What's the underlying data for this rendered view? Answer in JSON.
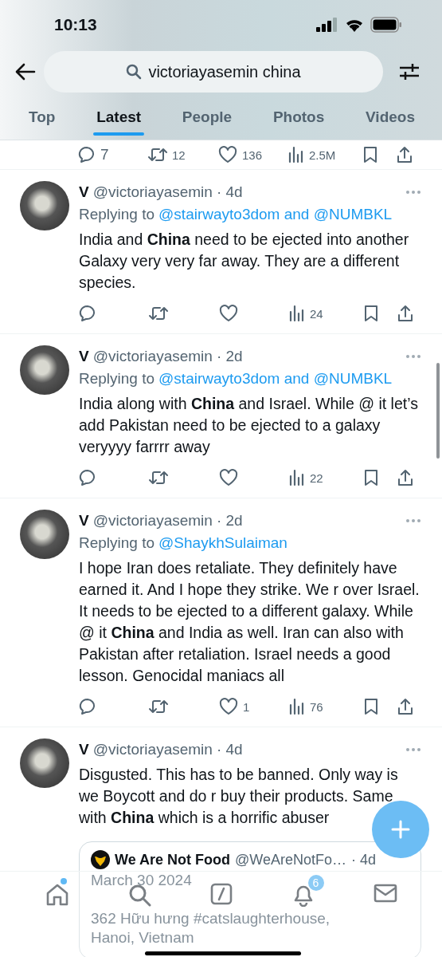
{
  "status_bar": {
    "time": "10:13"
  },
  "search": {
    "value": "victoriayasemin china"
  },
  "tabs": [
    {
      "label": "Top",
      "selected": false
    },
    {
      "label": "Latest",
      "selected": true
    },
    {
      "label": "People",
      "selected": false
    },
    {
      "label": "Photos",
      "selected": false
    },
    {
      "label": "Videos",
      "selected": false
    }
  ],
  "partial_actions": [
    {
      "kind": "reply",
      "count": "7"
    },
    {
      "kind": "retweet",
      "count": "12"
    },
    {
      "kind": "like",
      "count": "136"
    },
    {
      "kind": "views",
      "count": "2.5M"
    },
    {
      "kind": "bookmark"
    },
    {
      "kind": "share"
    }
  ],
  "tweets": [
    {
      "name": "V",
      "handle": "@victoriayasemin",
      "time": "· 4d",
      "replying_label": "Replying to",
      "replying_to": "@stairwayto3dom and @NUMBKL",
      "text": "India and **China** need to be ejected into another Galaxy very very far away.  They are a different species.",
      "actions": [
        {
          "kind": "reply"
        },
        {
          "kind": "retweet"
        },
        {
          "kind": "like"
        },
        {
          "kind": "views",
          "count": "24"
        },
        {
          "kind": "bookmark"
        },
        {
          "kind": "share"
        }
      ]
    },
    {
      "name": "V",
      "handle": "@victoriayasemin",
      "time": "· 2d",
      "replying_label": "Replying to",
      "replying_to": "@stairwayto3dom and @NUMBKL",
      "text": "India along with **China** and Israel. While @ it let’s add Pakistan need to be ejected to a galaxy veryyyy farrrr away",
      "actions": [
        {
          "kind": "reply"
        },
        {
          "kind": "retweet"
        },
        {
          "kind": "like"
        },
        {
          "kind": "views",
          "count": "22"
        },
        {
          "kind": "bookmark"
        },
        {
          "kind": "share"
        }
      ]
    },
    {
      "name": "V",
      "handle": "@victoriayasemin",
      "time": "· 2d",
      "replying_label": "Replying to",
      "replying_to": "@ShaykhSulaiman",
      "text": "I hope Iran does retaliate. They definitely have earned it. And I hope they strike. We r over Israel. It needs to be ejected to a different galaxy. While @ it **China** and India as well. Iran can also with Pakistan after retaliation. Israel needs a good lesson. Genocidal maniacs all",
      "actions": [
        {
          "kind": "reply"
        },
        {
          "kind": "retweet"
        },
        {
          "kind": "like",
          "count": "1"
        },
        {
          "kind": "views",
          "count": "76"
        },
        {
          "kind": "bookmark"
        },
        {
          "kind": "share"
        }
      ]
    },
    {
      "name": "V",
      "handle": "@victoriayasemin",
      "time": "· 4d",
      "text": "Disgusted. This has to be banned. Only way is we Boycott and do r buy their products. Same with **China** which is a horrific abuser",
      "quote": {
        "name": "We Are Not Food",
        "handle": "@WeAreNotFo…",
        "time": "· 4d",
        "lines": [
          "March 30 2024",
          "362 Hữu hưng  #catslaughterhouse,",
          "Hanoi, Vietnam"
        ]
      }
    }
  ],
  "nav": [
    {
      "kind": "home",
      "dot": true
    },
    {
      "kind": "search"
    },
    {
      "kind": "compose"
    },
    {
      "kind": "bell",
      "badge": "6"
    },
    {
      "kind": "mail"
    }
  ]
}
